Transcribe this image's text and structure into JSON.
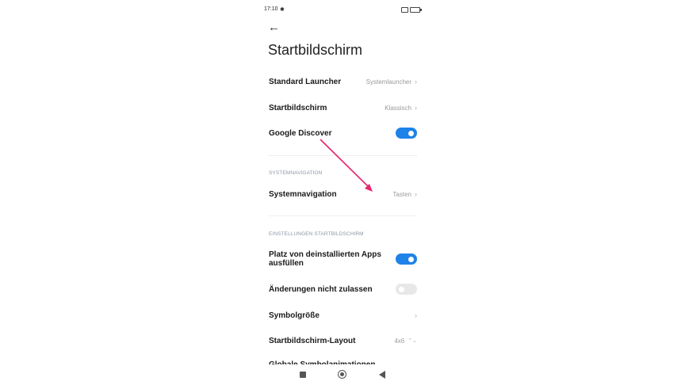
{
  "status_bar": {
    "time": "17:10"
  },
  "header": {
    "title": "Startbildschirm"
  },
  "rows": {
    "standard_launcher": {
      "label": "Standard Launcher",
      "value": "Systemlauncher"
    },
    "startbildschirm": {
      "label": "Startbildschirm",
      "value": "Klassisch"
    },
    "google_discover": {
      "label": "Google Discover",
      "toggle": "on"
    },
    "systemnavigation": {
      "label": "Systemnavigation",
      "value": "Tasten"
    },
    "platz": {
      "label": "Platz von deinstallierten Apps ausfüllen",
      "toggle": "on"
    },
    "aenderungen": {
      "label": "Änderungen nicht zulassen",
      "toggle": "off"
    },
    "symbolgroesse": {
      "label": "Symbolgröße"
    },
    "layout": {
      "label": "Startbildschirm-Layout",
      "value": "4x6"
    },
    "cut": {
      "label": "Globale Symbolanimationen"
    }
  },
  "sections": {
    "systemnavigation": "SYSTEMNAVIGATION",
    "einstellungen": "EINSTELLUNGEN STARTBILDSCHIRM"
  },
  "icons": {
    "chevron": "›",
    "updown": "⌃⌄",
    "back": "←",
    "gear": "✱"
  },
  "colors": {
    "accent": "#1e82e8",
    "annotation": "#e8246f"
  }
}
